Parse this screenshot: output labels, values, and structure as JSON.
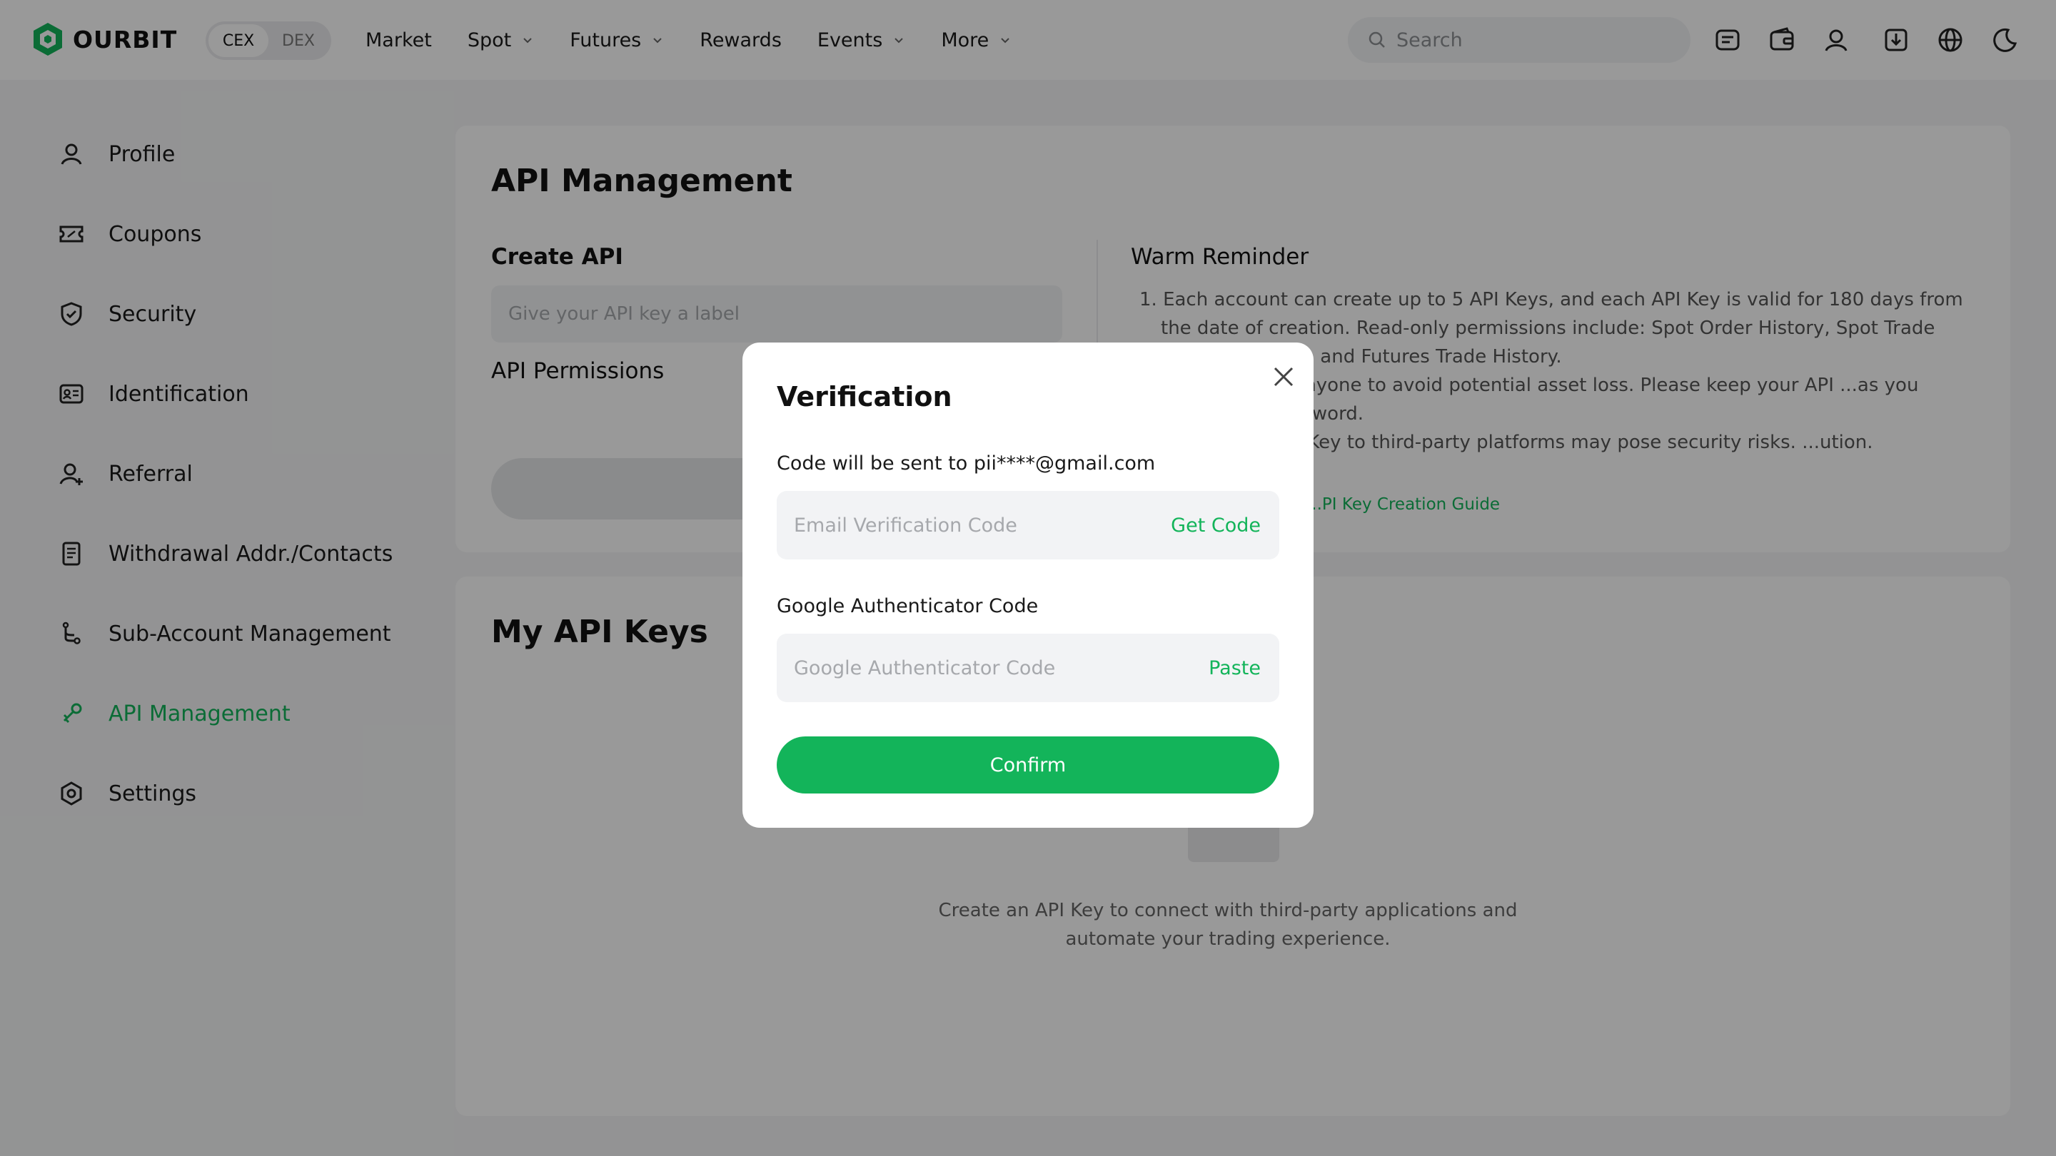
{
  "header": {
    "logo_text": "OURBIT",
    "toggle": {
      "cex": "CEX",
      "dex": "DEX"
    },
    "nav": [
      {
        "label": "Market",
        "dropdown": false
      },
      {
        "label": "Spot",
        "dropdown": true
      },
      {
        "label": "Futures",
        "dropdown": true
      },
      {
        "label": "Rewards",
        "dropdown": false
      },
      {
        "label": "Events",
        "dropdown": true
      },
      {
        "label": "More",
        "dropdown": true
      }
    ],
    "search_placeholder": "Search",
    "icons": [
      "message-icon",
      "wallet-icon",
      "user-icon",
      "download-icon",
      "globe-icon",
      "moon-icon"
    ]
  },
  "sidebar": {
    "items": [
      {
        "label": "Profile",
        "icon": "user-icon"
      },
      {
        "label": "Coupons",
        "icon": "coupon-icon"
      },
      {
        "label": "Security",
        "icon": "shield-icon"
      },
      {
        "label": "Identification",
        "icon": "id-card-icon"
      },
      {
        "label": "Referral",
        "icon": "user-plus-icon"
      },
      {
        "label": "Withdrawal Addr./Contacts",
        "icon": "document-icon"
      },
      {
        "label": "Sub-Account Management",
        "icon": "branch-icon"
      },
      {
        "label": "API Management",
        "icon": "link-icon"
      },
      {
        "label": "Settings",
        "icon": "settings-icon"
      }
    ]
  },
  "main": {
    "title": "API Management",
    "create_api": "Create API",
    "label_placeholder": "Give your API key a label",
    "permissions": "API Permissions",
    "warm_title": "Warm Reminder",
    "warm_items": [
      "1. Each account can create up to 5 API Keys, and each API Key is valid for 180 days from the date of creation. Read-only permissions include: Spot Order History, Spot Trade History, ...istory, and Futures Trade History.",
      "...our API Key to anyone to avoid potential asset loss. Please keep your API ...as you would your password.",
      "...linking your API Key to third-party platforms may pose security risks. ...ution."
    ],
    "guide_link": "...PI Key Creation Guide",
    "my_keys_title": "My API Keys",
    "empty_text": "Create an API Key to connect with third-party applications and automate your trading experience."
  },
  "modal": {
    "title": "Verification",
    "email_label": "Code will be sent to pii****@gmail.com",
    "email_placeholder": "Email Verification Code",
    "get_code": "Get Code",
    "ga_label": "Google Authenticator Code",
    "ga_placeholder": "Google Authenticator Code",
    "paste": "Paste",
    "confirm": "Confirm"
  },
  "colors": {
    "accent": "#13b45a",
    "overlay": "rgba(0,0,0,0.40)"
  }
}
